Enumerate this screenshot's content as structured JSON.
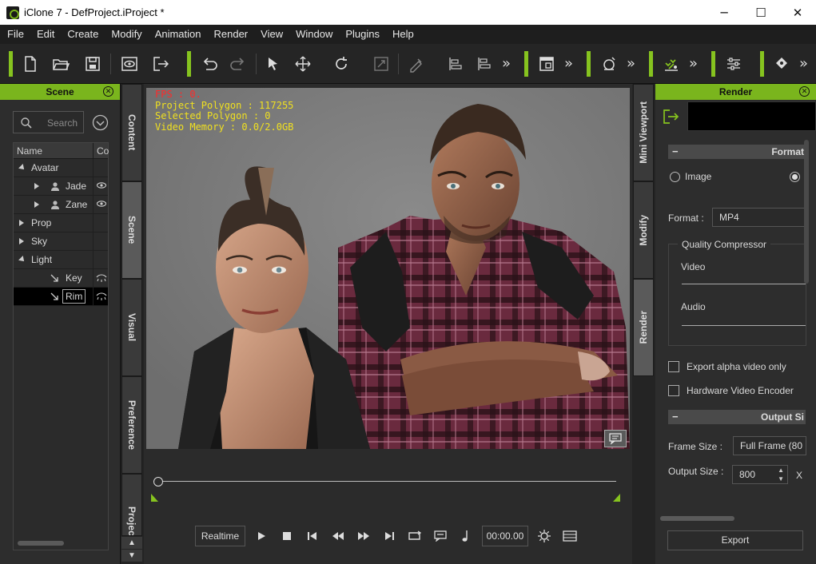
{
  "window": {
    "title": "iClone 7 - DefProject.iProject *",
    "minimize": "─",
    "maximize": "☐",
    "close": "✕"
  },
  "menu": [
    "File",
    "Edit",
    "Create",
    "Modify",
    "Animation",
    "Render",
    "View",
    "Window",
    "Plugins",
    "Help"
  ],
  "toolbar": {
    "more_glyph": "»",
    "icons": [
      "new-file-icon",
      "open-folder-icon",
      "save-icon",
      "preview-icon",
      "exit-icon",
      "undo-icon",
      "redo-icon",
      "select-arrow-icon",
      "move-icon",
      "rotate-icon",
      "scale-icon",
      "pick-tool-icon",
      "align-left-icon",
      "align-center-icon",
      "viewport-layout-icon",
      "camera-icon",
      "motion-icon",
      "settings-sliders-icon",
      "mark-icon"
    ]
  },
  "scene_panel": {
    "title": "Scene",
    "search_placeholder": "Search",
    "columns": [
      "Name",
      "Co"
    ],
    "items": [
      {
        "label": "Avatar",
        "level": 0,
        "expanded": true
      },
      {
        "label": "Jade",
        "level": 1,
        "expanded": false
      },
      {
        "label": "Zane",
        "level": 1,
        "expanded": false
      },
      {
        "label": "Prop",
        "level": 0,
        "expanded": false
      },
      {
        "label": "Sky",
        "level": 0,
        "expanded": false
      },
      {
        "label": "Light",
        "level": 0,
        "expanded": true
      },
      {
        "label": "Key",
        "level": 1,
        "expanded": false
      },
      {
        "label": "Rim",
        "level": 1,
        "expanded": false,
        "selected": true
      }
    ]
  },
  "left_tabs": [
    "Content",
    "Scene",
    "Visual",
    "Preference",
    "Project"
  ],
  "right_tabs": [
    "Mini Viewport",
    "Modify",
    "Render"
  ],
  "viewport": {
    "fps": "FPS : 0.",
    "polygon": "Project Polygon : 117255",
    "selected_polygon": "Selected Polygon : 0",
    "video_memory": "Video Memory : 0.0/2.0GB",
    "colors": {
      "fps": "#ff2a2a",
      "stats": "#f0e020",
      "accent": "#7ab51d"
    }
  },
  "playback": {
    "mode": "Realtime",
    "timecode": "00:00.00"
  },
  "render_panel": {
    "title": "Render",
    "format_section": "Format",
    "image_label": "Image",
    "format_label": "Format :",
    "format_value": "MP4",
    "quality_group": "Quality Compressor",
    "video_label": "Video",
    "audio_label": "Audio",
    "export_alpha": "Export alpha video only",
    "hw_encoder": "Hardware Video Encoder",
    "output_section": "Output Si",
    "frame_size_label": "Frame Size :",
    "frame_size_value": "Full Frame (80",
    "output_size_label": "Output Size :",
    "output_size_value": "800",
    "output_x": "X",
    "export_button": "Export"
  }
}
